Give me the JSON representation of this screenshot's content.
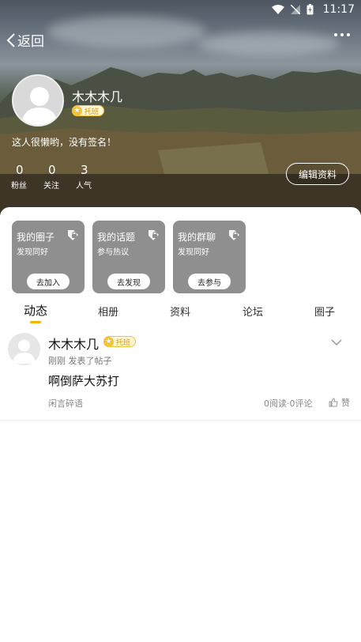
{
  "status_bar": {
    "time": "11:17"
  },
  "nav": {
    "back_label": "返回"
  },
  "profile": {
    "name": "木木木几",
    "badge": "托班",
    "signature": "这人很懒哟，没有签名！",
    "stats": [
      {
        "value": "0",
        "label": "粉丝"
      },
      {
        "value": "0",
        "label": "关注"
      },
      {
        "value": "3",
        "label": "人气"
      }
    ],
    "edit_label": "编辑资料"
  },
  "cards": [
    {
      "title": "我的圈子",
      "subtitle": "发现同好",
      "button": "去加入"
    },
    {
      "title": "我的话题",
      "subtitle": "参与热议",
      "button": "去发现"
    },
    {
      "title": "我的群聊",
      "subtitle": "发现同好",
      "button": "去参与"
    }
  ],
  "tabs": [
    {
      "label": "动态",
      "active": true
    },
    {
      "label": "相册"
    },
    {
      "label": "资料"
    },
    {
      "label": "论坛"
    },
    {
      "label": "圈子"
    }
  ],
  "post": {
    "author": "木木木几",
    "badge": "托班",
    "meta": "刚刚  发表了帖子",
    "content": "啊倒萨大苏打",
    "tag": "闲言碎语",
    "stats": "0阅读·0评论",
    "like_label": "赞"
  },
  "colors": {
    "accent": "#f3b400",
    "card_bg": "#8f8f8f"
  }
}
